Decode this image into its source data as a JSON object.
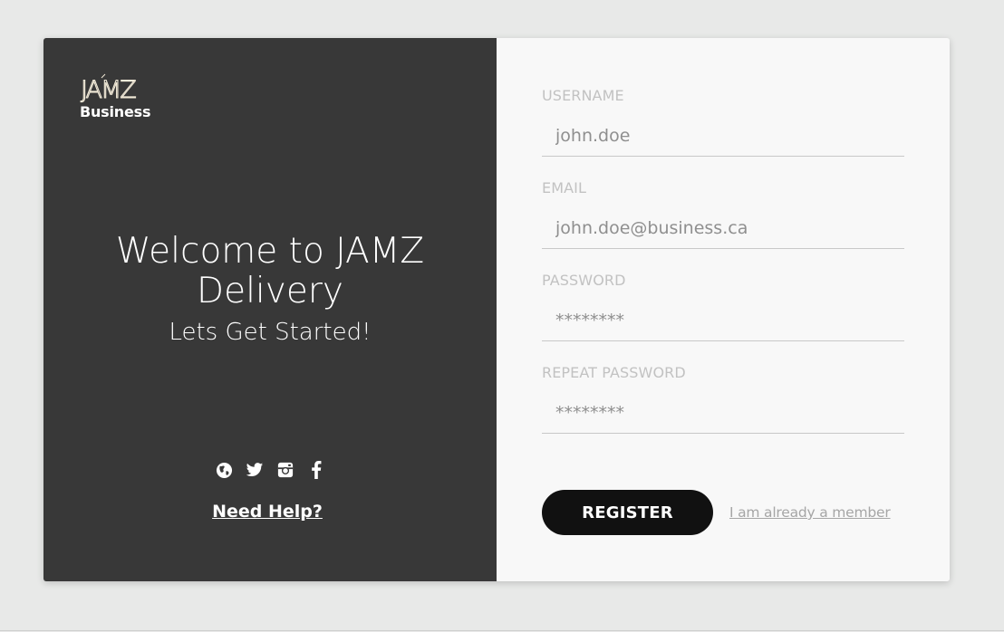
{
  "brand": {
    "logo_text": "JAMZ",
    "subtitle": "Business"
  },
  "welcome": {
    "title": "Welcome to JAMZ Delivery",
    "subtitle": "Lets Get Started!"
  },
  "social_icons": [
    "globe-icon",
    "twitter-icon",
    "instagram-icon",
    "facebook-icon"
  ],
  "help_link": "Need Help?",
  "form": {
    "username": {
      "label": "USERNAME",
      "value": "john.doe"
    },
    "email": {
      "label": "EMAIL",
      "value": "john.doe@business.ca"
    },
    "password": {
      "label": "PASSWORD",
      "value": "********"
    },
    "repeat_password": {
      "label": "REPEAT PASSWORD",
      "value": "********"
    }
  },
  "actions": {
    "register_label": "REGISTER",
    "member_link": "I am already a member"
  },
  "colors": {
    "page_bg": "#e8e9e8",
    "left_panel": "#383838",
    "right_panel": "#f8f8f8",
    "button": "#111111",
    "label": "#c2c2c2",
    "input_text": "#8f8f8f"
  }
}
